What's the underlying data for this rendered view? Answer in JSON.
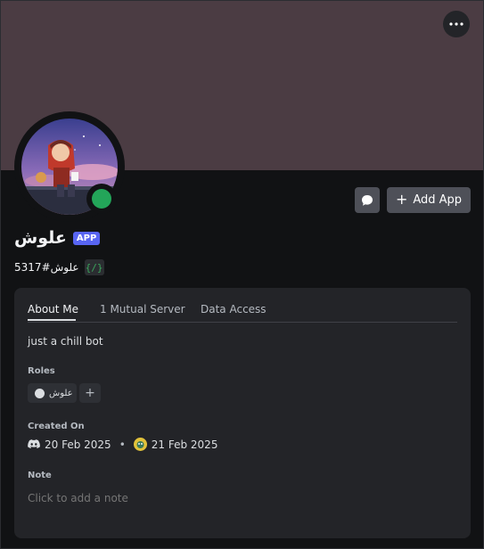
{
  "profile": {
    "display_name": "علوش",
    "app_badge": "APP",
    "username": "علوش#5317",
    "slash_badge": "{/}",
    "status": "online",
    "status_color": "#23a559",
    "banner_color": "#4b3c43"
  },
  "actions": {
    "add_app_label": "Add App",
    "add_app_icon": "plus-icon",
    "message_icon": "chat-bubble-icon",
    "more_icon": "ellipsis-icon"
  },
  "tabs": [
    {
      "label": "About Me",
      "active": true
    },
    {
      "label": "1 Mutual Server",
      "active": false
    },
    {
      "label": "Data Access",
      "active": false
    }
  ],
  "about": {
    "bio": "just a chill bot",
    "roles_title": "Roles",
    "roles": [
      {
        "name": "علوش",
        "color": "#dbdee1"
      }
    ],
    "add_role_symbol": "+",
    "created_title": "Created On",
    "created_discord": "20 Feb 2025",
    "created_discord_icon": "discord-icon",
    "bullet": "•",
    "created_server": "21 Feb 2025",
    "created_server_icon": "server-icon",
    "note_title": "Note",
    "note_placeholder": "Click to add a note"
  }
}
